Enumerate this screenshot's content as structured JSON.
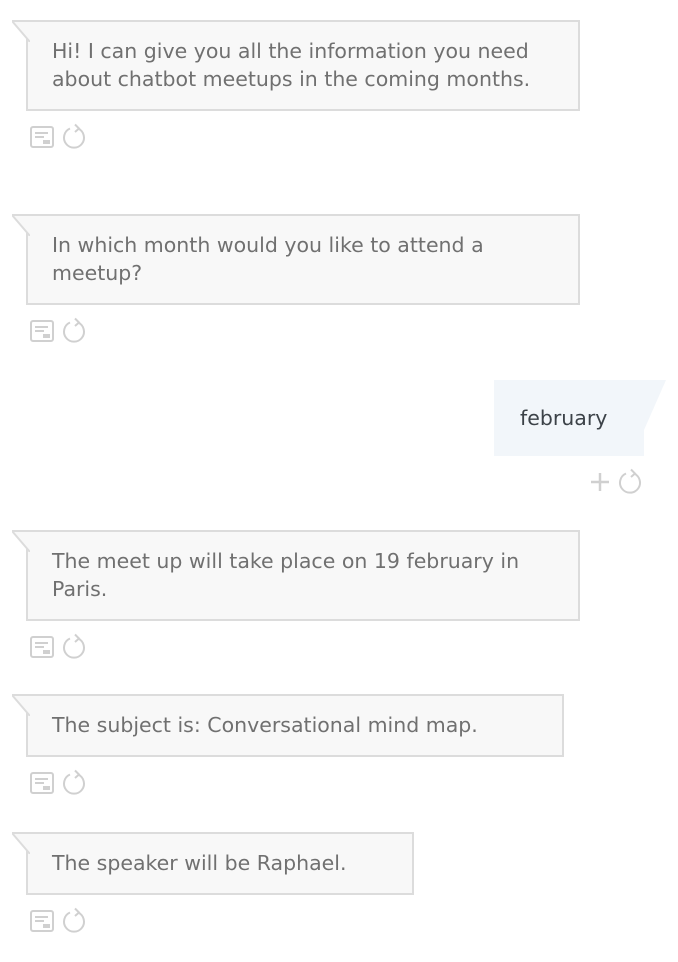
{
  "messages": [
    {
      "from": "bot",
      "text": "Hi! I can give you all the information you need about chatbot meetups in the coming months.",
      "icons": [
        "card-icon",
        "replay-icon"
      ]
    },
    {
      "from": "bot",
      "text": "In which month would you like to attend a meetup?",
      "icons": [
        "card-icon",
        "replay-icon"
      ]
    },
    {
      "from": "user",
      "text": "february",
      "icons": [
        "plus-icon",
        "replay-icon"
      ]
    },
    {
      "from": "bot",
      "text": "The meet up will take place on 19 february in Paris.",
      "icons": [
        "card-icon",
        "replay-icon"
      ]
    },
    {
      "from": "bot",
      "text": "The subject is: Conversational mind map.",
      "icons": [
        "card-icon",
        "replay-icon"
      ]
    },
    {
      "from": "bot",
      "text": "The speaker will be Raphael.",
      "icons": [
        "card-icon",
        "replay-icon"
      ]
    }
  ],
  "colors": {
    "bot_bubble_bg": "#f8f8f8",
    "bot_bubble_border": "#dcdcdc",
    "bot_text": "#707070",
    "user_bubble_bg": "#f2f6fa",
    "user_text": "#3c4248",
    "icon": "#d0d0d0"
  }
}
